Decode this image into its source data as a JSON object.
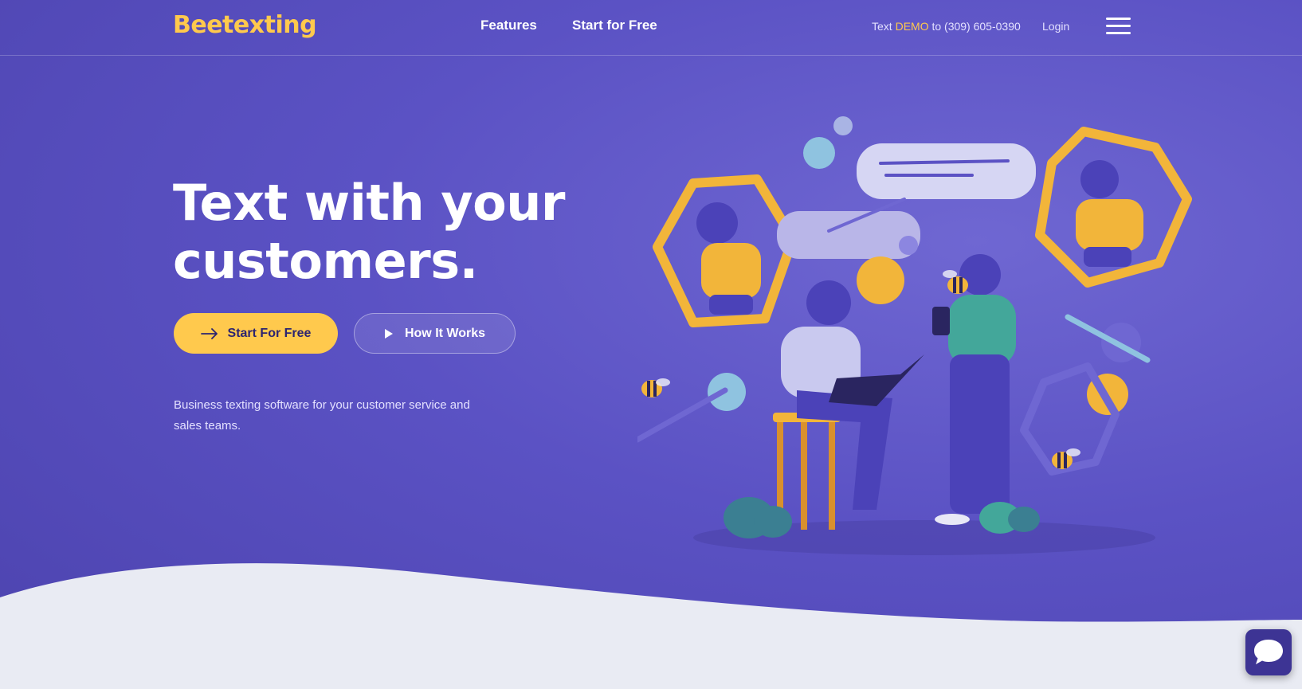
{
  "header": {
    "logo": "Beetexting",
    "nav": [
      "Features",
      "Start for Free"
    ],
    "demo": {
      "prefix": "Text",
      "keyword": "DEMO",
      "suffix": "to (309) 605-0390"
    },
    "login": "Login",
    "menu_icon": "hamburger-icon"
  },
  "hero": {
    "headline_line1": "Text with your",
    "headline_line2": "customers.",
    "primary_button": "Start For Free",
    "secondary_button": "How It Works",
    "tagline": "Business texting software for your customer service and sales teams."
  },
  "chat_widget": {
    "icon": "chat-bubble-icon"
  },
  "colors": {
    "brand_yellow": "#ffc94d",
    "hero_purple": "#5b52c4",
    "wave_background": "#e9ebf3",
    "chat_widget": "#3d3494"
  }
}
